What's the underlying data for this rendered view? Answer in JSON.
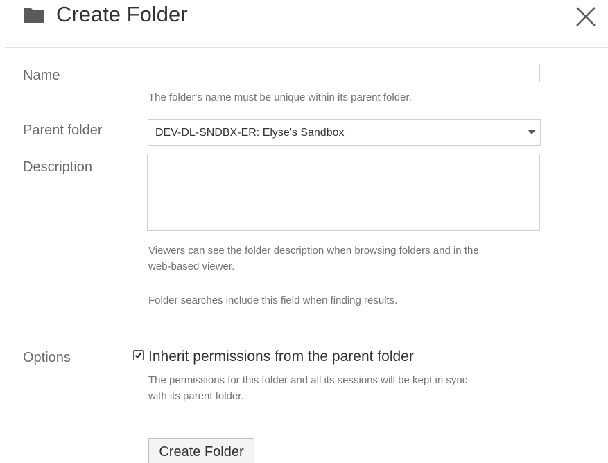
{
  "dialog": {
    "title": "Create Folder",
    "folder_icon": "folder-icon",
    "close_icon": "close-icon"
  },
  "form": {
    "name": {
      "label": "Name",
      "value": "",
      "help": "The folder's name must be unique within its parent folder."
    },
    "parent_folder": {
      "label": "Parent folder",
      "selected": "DEV-DL-SNDBX-ER: Elyse's Sandbox",
      "caret_icon": "caret-down-icon"
    },
    "description": {
      "label": "Description",
      "value": "",
      "help_line1": "Viewers can see the folder description when browsing folders and in the",
      "help_line2": "web-based viewer.",
      "help_search": "Folder searches include this field when finding results."
    },
    "options": {
      "label": "Options",
      "inherit_checked": true,
      "inherit_label": "Inherit permissions from the parent folder",
      "inherit_help_line1": "The permissions for this folder and all its sessions will be kept in sync",
      "inherit_help_line2": "with its parent folder."
    },
    "submit_label": "Create Folder"
  }
}
